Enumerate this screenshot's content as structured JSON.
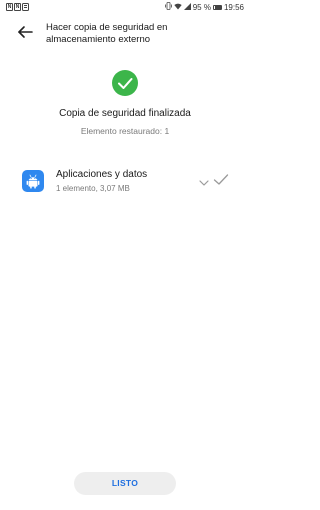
{
  "status_bar": {
    "left_icons": [
      "sim-card-icon",
      "sim-card-icon",
      "notification-icon"
    ],
    "sim1_label": "N",
    "sim2_label": "N",
    "battery_percent": "95 %",
    "time": "19:56"
  },
  "header": {
    "back_icon": "arrow-left-icon",
    "title": "Hacer copia de seguridad en almacenamiento externo"
  },
  "result": {
    "status_icon": "check-circle-icon",
    "status_color": "#3cb54a",
    "title": "Copia de seguridad finalizada",
    "subtitle": "Elemento restaurado: 1"
  },
  "items": [
    {
      "icon": "android-icon",
      "icon_color": "#2f88ef",
      "title": "Aplicaciones y datos",
      "subtitle": "1 elemento, 3,07 MB",
      "expand_icon": "chevron-down-icon",
      "state_icon": "check-icon"
    }
  ],
  "footer": {
    "done_label": "LISTO",
    "accent_color": "#1f6fe0"
  }
}
